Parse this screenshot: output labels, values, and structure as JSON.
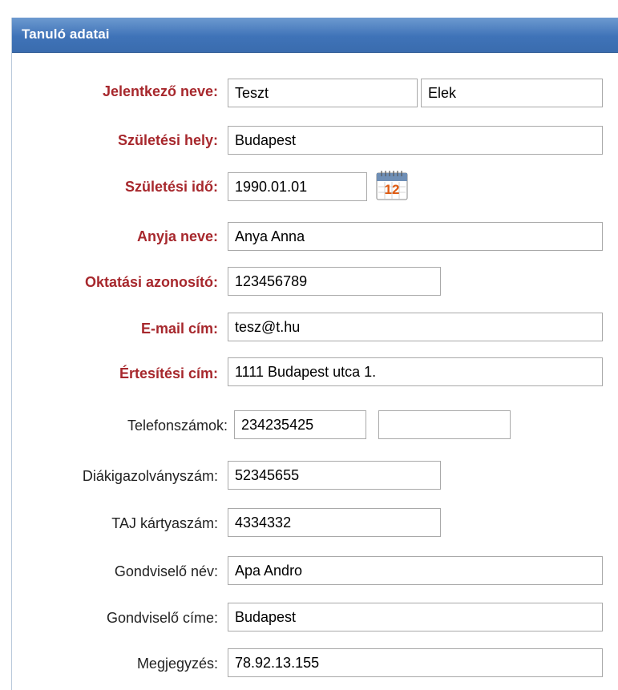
{
  "panel": {
    "title": "Tanuló adatai"
  },
  "fields": {
    "jelentkezo_neve": {
      "label": "Jelentkező neve:",
      "first": "Teszt",
      "last": "Elek"
    },
    "szuletesi_hely": {
      "label": "Születési hely:",
      "value": "Budapest"
    },
    "szuletesi_ido": {
      "label": "Születési idő:",
      "value": "1990.01.01",
      "calendar_day": "12"
    },
    "anyja_neve": {
      "label": "Anyja neve:",
      "value": "Anya Anna"
    },
    "oktatasi_azonosito": {
      "label": "Oktatási azonosító:",
      "value": "123456789"
    },
    "email": {
      "label": "E-mail cím:",
      "value": "tesz@t.hu"
    },
    "ertesitesi_cim": {
      "label": "Értesítési cím:",
      "value": "1111 Budapest utca 1."
    },
    "telefonszamok": {
      "label": "Telefonszámok:",
      "phone1": "234235425",
      "phone2": ""
    },
    "diakigazolvany": {
      "label": "Diákigazolványszám:",
      "value": "52345655"
    },
    "taj": {
      "label": "TAJ kártyaszám:",
      "value": "4334332"
    },
    "gondviselo_nev": {
      "label": "Gondviselő név:",
      "value": "Apa Andro"
    },
    "gondviselo_cime": {
      "label": "Gondviselő címe:",
      "value": "Budapest"
    },
    "megjegyzes": {
      "label": "Megjegyzés:",
      "value": "78.92.13.155"
    }
  },
  "colors": {
    "required_label": "#a7282d",
    "header_bg": "#3f73b8",
    "header_text": "#ffffff",
    "calendar_accent": "#e05a10"
  },
  "icons": {
    "calendar": "calendar-icon"
  }
}
